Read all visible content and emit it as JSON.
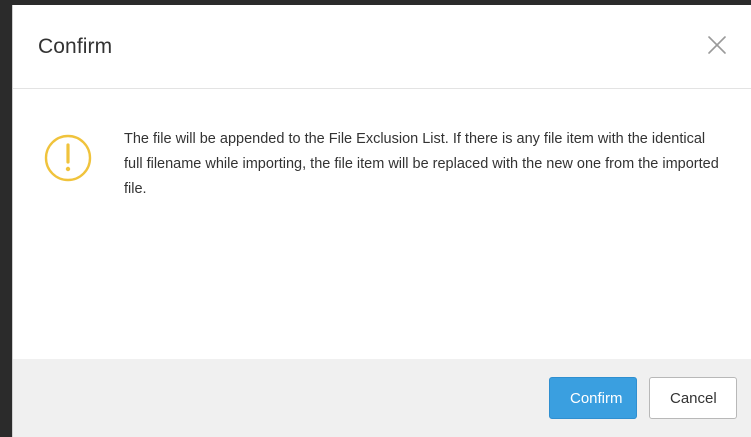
{
  "dialog": {
    "title": "Confirm",
    "message": "The file will be appended to the File Exclusion List. If there is any file item with the identical full filename while importing, the file item will be replaced with the new one from the imported file.",
    "icons": {
      "close": "close-icon",
      "warning": "warning-icon"
    },
    "buttons": {
      "confirm_label": "Confirm",
      "cancel_label": "Cancel"
    },
    "colors": {
      "primary": "#3a9fe0",
      "warning": "#f0c33c",
      "footer_bg": "#f0f0f0",
      "text": "#333333"
    }
  }
}
